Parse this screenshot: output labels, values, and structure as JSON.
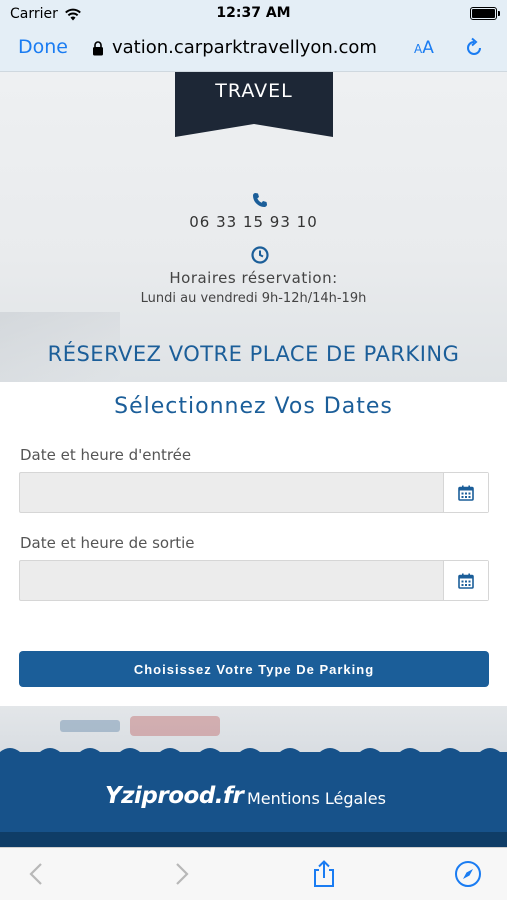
{
  "status_bar": {
    "carrier": "Carrier",
    "time": "12:37 AM"
  },
  "browser": {
    "done_label": "Done",
    "url": "vation.carparktravellyon.com",
    "text_size_label_small": "A",
    "text_size_label_large": "A"
  },
  "header": {
    "logo_text": "TRAVEL",
    "phone": "06 33 15 93 10",
    "hours_title": "Horaires réservation:",
    "hours_text": "Lundi au vendredi 9h-12h/14h-19h",
    "reserve_title": "RÉSERVEZ VOTRE PLACE DE PARKING"
  },
  "form": {
    "title": "Sélectionnez Vos Dates",
    "entry_label": "Date et heure d'entrée",
    "entry_value": "",
    "exit_label": "Date et heure de sortie",
    "exit_value": "",
    "submit_label": "Choisissez Votre Type De Parking"
  },
  "footer": {
    "logo_text": "Yziprood.fr",
    "legal_link": "Mentions Légales"
  },
  "colors": {
    "accent": "#1b5e99",
    "ios_blue": "#1a7cf2",
    "footer_band": "#17528a"
  }
}
